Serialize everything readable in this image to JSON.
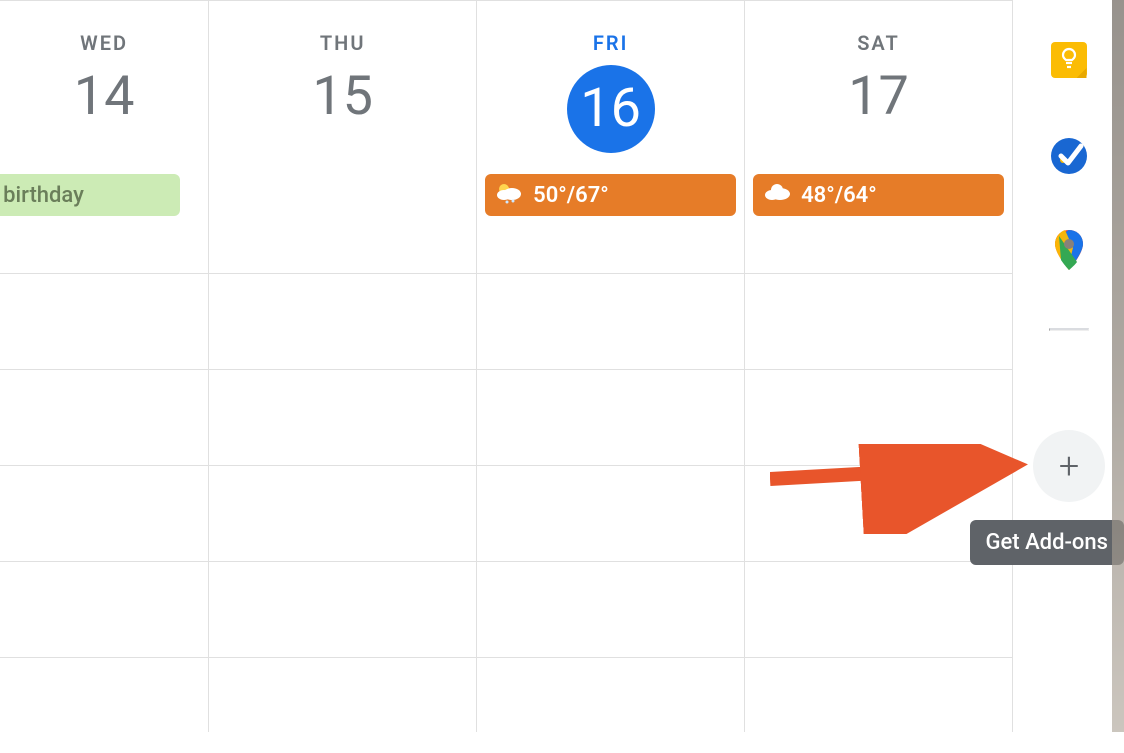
{
  "calendar": {
    "days": [
      {
        "name": "WED",
        "number": "14",
        "today": false
      },
      {
        "name": "THU",
        "number": "15",
        "today": false
      },
      {
        "name": "FRI",
        "number": "16",
        "today": true
      },
      {
        "name": "SAT",
        "number": "17",
        "today": false
      }
    ],
    "birthday_event": "l's birthday",
    "weather": {
      "fri": "50°/67°",
      "sat": "48°/64°"
    }
  },
  "sidepanel": {
    "tooltip": "Get Add-ons",
    "plus": "+"
  }
}
